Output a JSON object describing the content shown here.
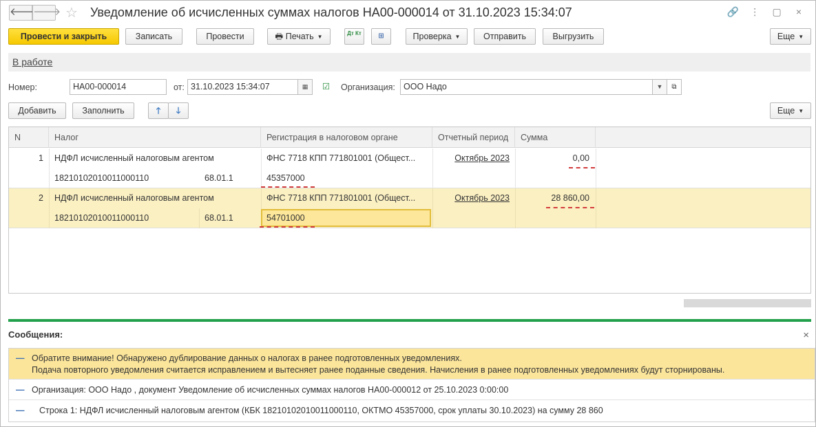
{
  "window": {
    "title": "Уведомление об исчисленных суммах налогов НА00-000014 от 31.10.2023 15:34:07",
    "nav_back": "🡐",
    "nav_forward": "🡒",
    "star": "☆",
    "link_icon": "🔗",
    "more_icon": "⋮",
    "maximize_icon": "▢",
    "close_icon": "×"
  },
  "toolbar": {
    "post_close": "Провести и закрыть",
    "save": "Записать",
    "post": "Провести",
    "print": "Печать",
    "dtkt": "Дт Кт",
    "check": "Проверка",
    "send": "Отправить",
    "export": "Выгрузить",
    "more": "Еще"
  },
  "status": {
    "label": "В работе"
  },
  "form": {
    "number_label": "Номер:",
    "number_value": "НА00-000014",
    "date_label": "от:",
    "date_value": "31.10.2023 15:34:07",
    "org_label": "Организация:",
    "org_value": "ООО Надо"
  },
  "table_toolbar": {
    "add": "Добавить",
    "fill": "Заполнить",
    "more": "Еще"
  },
  "table": {
    "columns": [
      "N",
      "Налог",
      "Регистрация в налоговом органе",
      "Отчетный период",
      "Сумма"
    ],
    "rows": [
      {
        "n": "1",
        "tax": "НДФЛ исчисленный налоговым агентом",
        "kbk": "18210102010011000110",
        "account": "68.01.1",
        "registration": "ФНС 7718 КПП 771801001 (Общест...",
        "oktmo": "45357000",
        "period": "Октябрь 2023",
        "sum": "0,00"
      },
      {
        "n": "2",
        "tax": "НДФЛ исчисленный налоговым агентом",
        "kbk": "18210102010011000110",
        "account": "68.01.1",
        "registration": "ФНС 7718 КПП 771801001 (Общест...",
        "oktmo": "54701000",
        "period": "Октябрь 2023",
        "sum": "28 860,00"
      }
    ]
  },
  "messages": {
    "header": "Сообщения:",
    "close": "×",
    "items": [
      {
        "line1": "Обратите внимание! Обнаружено дублирование данных о налогах в ранее подготовленных уведомлениях.",
        "line2": "Подача повторного уведомления считается исправлением и вытесняет ранее поданные сведения. Начисления в ранее подготовленных уведомлениях будут сторнированы."
      },
      {
        "line1": "Организация: ООО Надо , документ Уведомление об исчисленных суммах налогов НА00-000012 от 25.10.2023 0:00:00"
      },
      {
        "line1": "Строка 1: НДФЛ исчисленный налоговым агентом (КБК 18210102010011000110, ОКТМО 45357000, срок уплаты 30.10.2023) на сумму 28 860"
      }
    ]
  },
  "colors": {
    "primary_button": "#f6c800",
    "selected_row": "#fbf0c2",
    "green_divider": "#22a04b",
    "warning": "#fbe59b"
  }
}
